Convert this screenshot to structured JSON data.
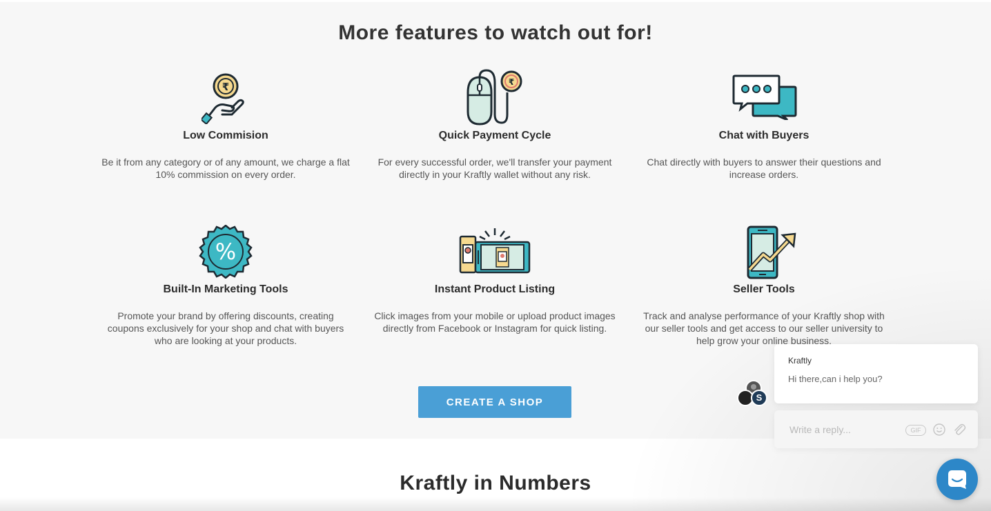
{
  "features_section": {
    "title": "More features to watch out for!",
    "items": [
      {
        "title": "Low Commision",
        "description": "Be it from any category or of any amount, we charge a flat 10% commission on every order.",
        "icon": "coin-hand-icon"
      },
      {
        "title": "Quick Payment Cycle",
        "description": "For every successful order, we'll transfer your payment directly in your Kraftly wallet without any risk.",
        "icon": "mouse-coin-icon"
      },
      {
        "title": "Chat with Buyers",
        "description": "Chat directly with buyers to answer their questions and increase orders.",
        "icon": "chat-bubbles-icon"
      },
      {
        "title": "Built-In Marketing Tools",
        "description": "Promote your brand by offering discounts, creating coupons exclusively for your shop and chat with buyers who are looking at your products.",
        "icon": "percent-badge-icon"
      },
      {
        "title": "Instant Product Listing",
        "description": "Click images from your mobile or upload product images directly from Facebook or Instagram for quick listing.",
        "icon": "phone-camera-icon"
      },
      {
        "title": "Seller Tools",
        "description": "Track and analyse performance of your Kraftly shop with our seller tools and get access to our seller university to help grow your online business.",
        "icon": "phone-growth-icon"
      }
    ],
    "cta_label": "CREATE A SHOP"
  },
  "numbers_section": {
    "title": "Kraftly in Numbers"
  },
  "chat_widget": {
    "sender": "Kraftly",
    "message": "Hi there,can i help you?",
    "reply_placeholder": "Write a reply...",
    "gif_label": "GIF",
    "avatar_initial": "S"
  },
  "colors": {
    "accent": "#4a9fd6",
    "teal": "#3db8c4",
    "gold": "#f6d98f",
    "dark": "#1e2a32",
    "launcher": "#2d87c8"
  }
}
